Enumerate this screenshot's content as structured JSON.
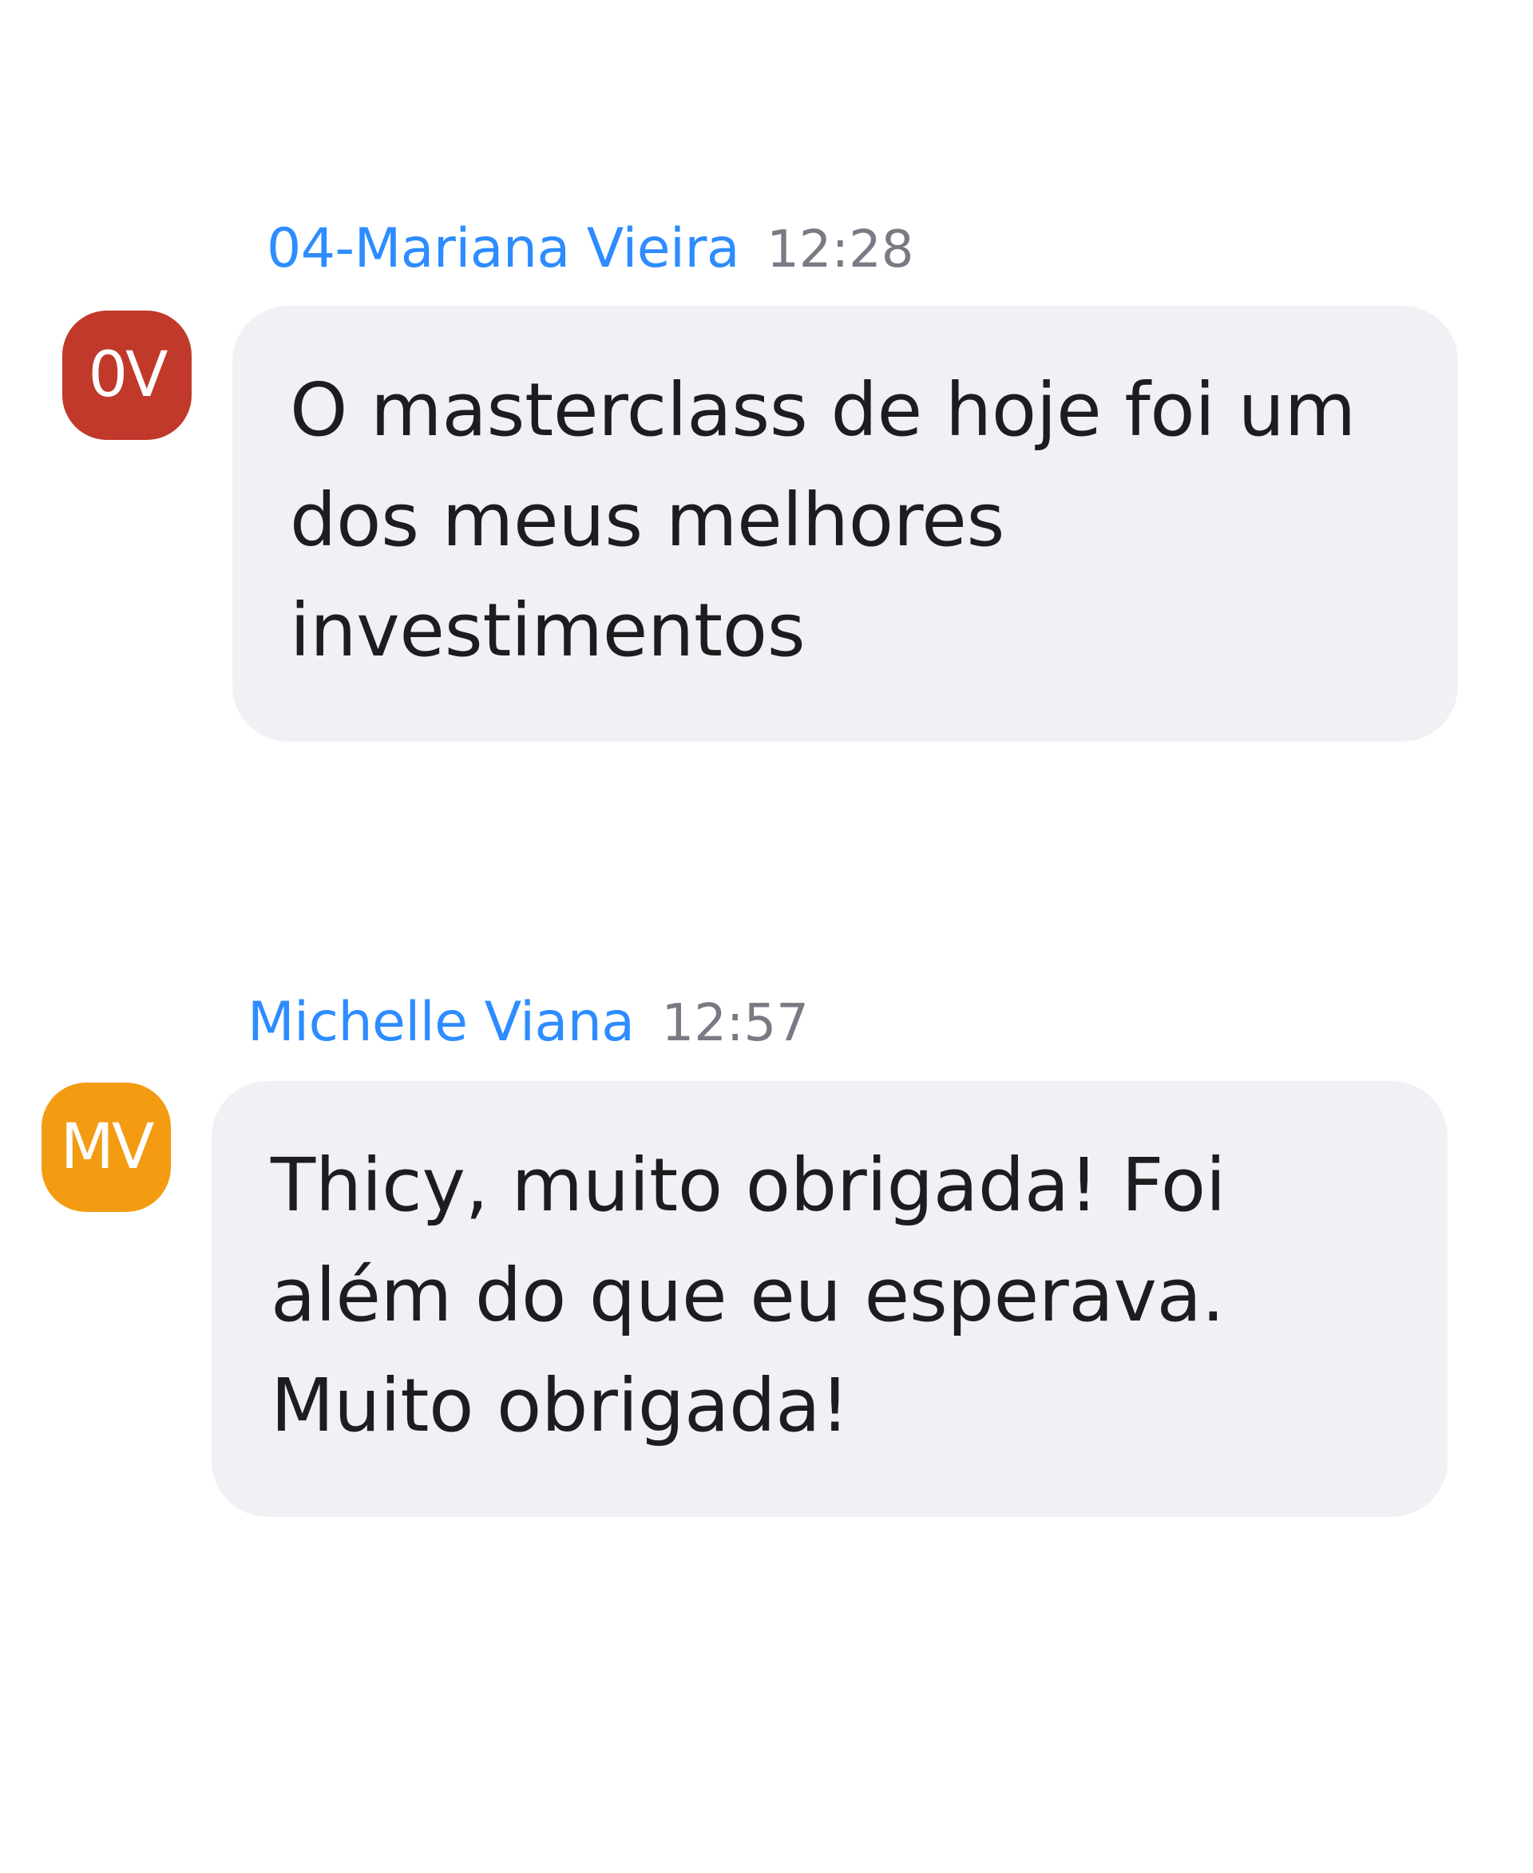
{
  "messages": [
    {
      "sender": "04-Mariana Vieira",
      "time": "12:28",
      "avatar_initials": "0V",
      "avatar_color": "#c0392b",
      "sender_color": "#2d8cff",
      "text": "O masterclass de hoje foi um dos meus melhores investimentos"
    },
    {
      "sender": "Michelle Viana",
      "time": "12:57",
      "avatar_initials": "MV",
      "avatar_color": "#f39c12",
      "sender_color": "#2d8cff",
      "text": "Thicy, muito obrigada! Foi além do que eu esperava. Muito obrigada!"
    }
  ],
  "colors": {
    "bubble_background": "#f1f0f5",
    "timestamp": "#7a7a85",
    "message_text": "#1d1d1f"
  }
}
